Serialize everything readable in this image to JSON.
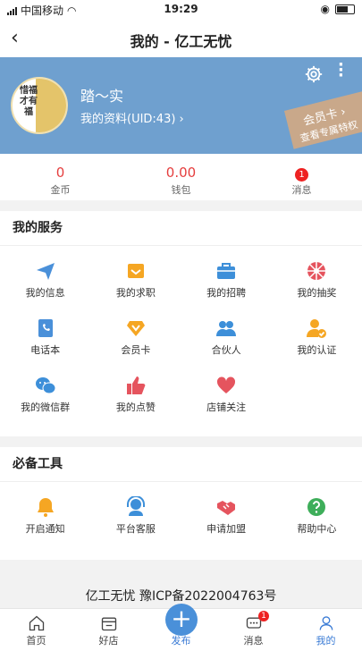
{
  "status": {
    "carrier": "中国移动",
    "time": "19:29"
  },
  "nav": {
    "title": "我的 - 亿工无忧",
    "back": "‹"
  },
  "profile": {
    "avatar_text": "惜福才有福",
    "name": "踏～实",
    "info": "我的资料(UID:43) ›",
    "vip_label": "会员卡 ›",
    "vip_sub": "查看专属特权"
  },
  "stats": [
    {
      "value": "0",
      "label": "金币"
    },
    {
      "value": "0.00",
      "label": "钱包"
    },
    {
      "value": "",
      "label": "消息",
      "badge": "1"
    }
  ],
  "services": {
    "title": "我的服务",
    "items": [
      {
        "label": "我的信息",
        "icon": "paper-plane-icon",
        "color": "#4a90d9"
      },
      {
        "label": "我的求职",
        "icon": "envelope-icon",
        "color": "#f5a623"
      },
      {
        "label": "我的招聘",
        "icon": "briefcase-icon",
        "color": "#3d8fd9"
      },
      {
        "label": "我的抽奖",
        "icon": "prize-wheel-icon",
        "color": "#e5545e"
      },
      {
        "label": "电话本",
        "icon": "phonebook-icon",
        "color": "#4a90d9"
      },
      {
        "label": "会员卡",
        "icon": "vip-diamond-icon",
        "color": "#f5a623"
      },
      {
        "label": "合伙人",
        "icon": "partners-icon",
        "color": "#3d8fd9"
      },
      {
        "label": "我的认证",
        "icon": "verified-user-icon",
        "color": "#f5a623"
      },
      {
        "label": "我的微信群",
        "icon": "wechat-icon",
        "color": "#3d8fd9"
      },
      {
        "label": "我的点赞",
        "icon": "thumbs-up-icon",
        "color": "#e5545e"
      },
      {
        "label": "店铺关注",
        "icon": "heart-icon",
        "color": "#e5545e"
      }
    ]
  },
  "tools": {
    "title": "必备工具",
    "items": [
      {
        "label": "开启通知",
        "icon": "bell-icon",
        "color": "#f5a623"
      },
      {
        "label": "平台客服",
        "icon": "headset-icon",
        "color": "#3d8fd9"
      },
      {
        "label": "申请加盟",
        "icon": "handshake-icon",
        "color": "#e5545e"
      },
      {
        "label": "帮助中心",
        "icon": "help-icon",
        "color": "#3eae5a"
      }
    ]
  },
  "footer": {
    "icp": "亿工无忧 豫ICP备2022004763号"
  },
  "tabbar": {
    "items": [
      {
        "label": "首页",
        "icon": "home-icon"
      },
      {
        "label": "好店",
        "icon": "shop-icon"
      },
      {
        "label": "发布",
        "icon": "plus-icon"
      },
      {
        "label": "消息",
        "icon": "chat-icon",
        "badge": "1"
      },
      {
        "label": "我的",
        "icon": "user-icon"
      }
    ]
  }
}
